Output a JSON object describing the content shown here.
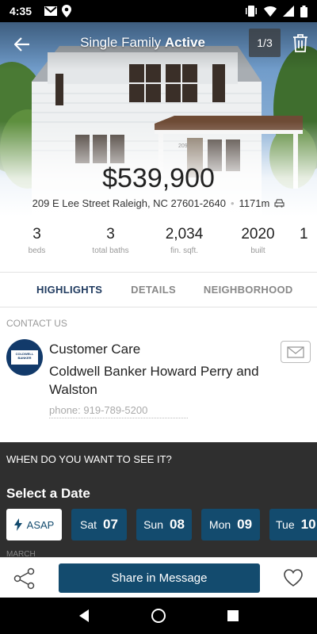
{
  "status_bar": {
    "time": "4:35"
  },
  "header": {
    "title_type": "Single Family",
    "title_status": "Active",
    "photo_counter": "1/3"
  },
  "listing": {
    "price": "$539,900",
    "address": "209 E Lee Street Raleigh, NC 27601-2640",
    "distance": "1171m"
  },
  "stats": [
    {
      "value": "3",
      "label": "beds"
    },
    {
      "value": "3",
      "label": "total baths"
    },
    {
      "value": "2,034",
      "label": "fin. sqft."
    },
    {
      "value": "2020",
      "label": "built"
    },
    {
      "value": "1",
      "label": ""
    }
  ],
  "tabs": [
    {
      "label": "HIGHLIGHTS",
      "active": true
    },
    {
      "label": "DETAILS",
      "active": false
    },
    {
      "label": "NEIGHBORHOOD",
      "active": false
    }
  ],
  "contact": {
    "section_label": "CONTACT US",
    "name": "Customer Care",
    "company": "Coldwell Banker Howard Perry and Walston",
    "phone": "phone: 919-789-5200",
    "logo_text": "COLDWELL BANKER HOWARD PERRY AND WALSTON"
  },
  "schedule": {
    "question": "WHEN DO YOU WANT TO SEE IT?",
    "select_label": "Select a Date",
    "asap_label": "ASAP",
    "dates": [
      {
        "dow": "Sat",
        "day": "07"
      },
      {
        "dow": "Sun",
        "day": "08"
      },
      {
        "dow": "Mon",
        "day": "09"
      },
      {
        "dow": "Tue",
        "day": "10"
      }
    ],
    "month": "MARCH"
  },
  "actions": {
    "share_message_label": "Share in Message"
  },
  "colors": {
    "brand": "#134b6e",
    "tab_active": "#1f3a5f",
    "dark_panel": "#2f2f2f"
  }
}
